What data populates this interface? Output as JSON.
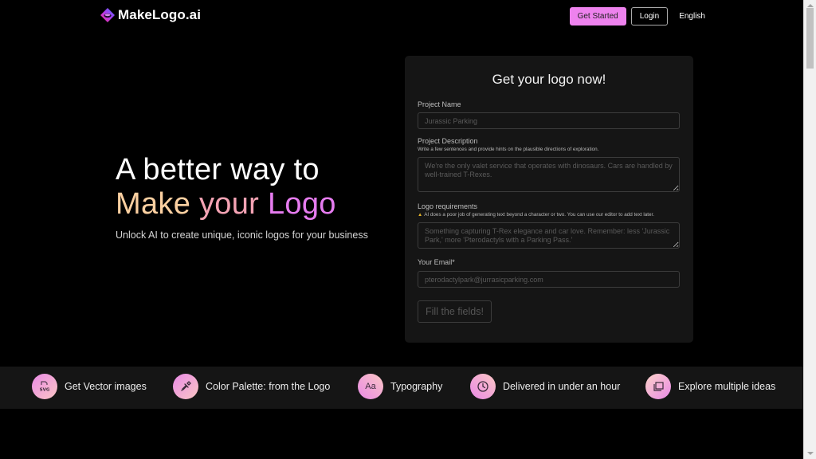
{
  "header": {
    "brand": "MakeLogo.ai",
    "get_started_label": "Get Started",
    "login_label": "Login",
    "language_label": "English"
  },
  "hero": {
    "line1": "A better way to",
    "line2_words": [
      "Make",
      "your",
      "Logo"
    ],
    "subtitle": "Unlock AI to create unique, iconic logos for your business",
    "colors": {
      "make": "#fcd0a1",
      "your": "#f4a3b4",
      "logo": "#e67cf0"
    }
  },
  "form": {
    "title": "Get your logo now!",
    "project_name": {
      "label": "Project Name",
      "placeholder": "Jurassic Parking",
      "value": ""
    },
    "project_description": {
      "label": "Project Description",
      "hint": "Write a few sentences and provide hints on the plausible directions of exploration.",
      "placeholder": "We're the only valet service that operates with dinosaurs. Cars are handled by well-trained T-Rexes.",
      "value": ""
    },
    "logo_requirements": {
      "label": "Logo requirements",
      "warning_icon": "warning-icon",
      "hint": "AI does a poor job of generating text beyond a character or two. You can use our editor to add text later.",
      "placeholder": "Something capturing T-Rex elegance and car love. Remember: less 'Jurassic Park,' more 'Pterodactyls with a Parking Pass.'",
      "value": ""
    },
    "email": {
      "label": "Your Email*",
      "placeholder": "pterodactylpark@jurrasicparking.com",
      "value": ""
    },
    "submit_label": "Fill the fields!"
  },
  "features": [
    {
      "icon": "svg-file-icon",
      "label": "Get Vector images"
    },
    {
      "icon": "color-picker-icon",
      "label": "Color Palette: from the Logo"
    },
    {
      "icon": "typography-icon",
      "label": "Typography",
      "glyph": "Aa"
    },
    {
      "icon": "clock-icon",
      "label": "Delivered in under an hour"
    },
    {
      "icon": "copy-icon",
      "label": "Explore multiple ideas"
    }
  ],
  "colors": {
    "accent": "#ee82ee",
    "background": "#000000",
    "card": "#151515"
  }
}
